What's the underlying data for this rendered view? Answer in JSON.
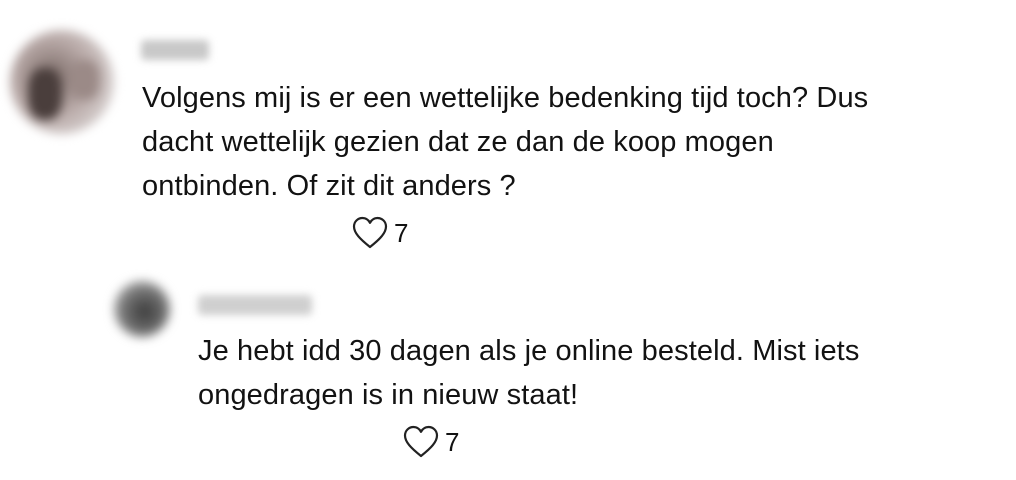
{
  "comments": [
    {
      "author_name": "",
      "text_lines": [
        "Volgens mij is er een wettelijke bedenking tijd toch? Dus",
        "dacht wettelijk gezien dat ze dan de koop mogen",
        "ontbinden. Of zit dit anders ?"
      ],
      "like_count": "7",
      "like_icon": "heart-outline-icon"
    },
    {
      "author_name": "",
      "text_lines": [
        "Je hebt idd 30 dagen als je online besteld. Mist iets",
        "ongedragen is in nieuw staat!"
      ],
      "like_count": "7",
      "like_icon": "heart-outline-icon",
      "is_reply": true
    }
  ]
}
